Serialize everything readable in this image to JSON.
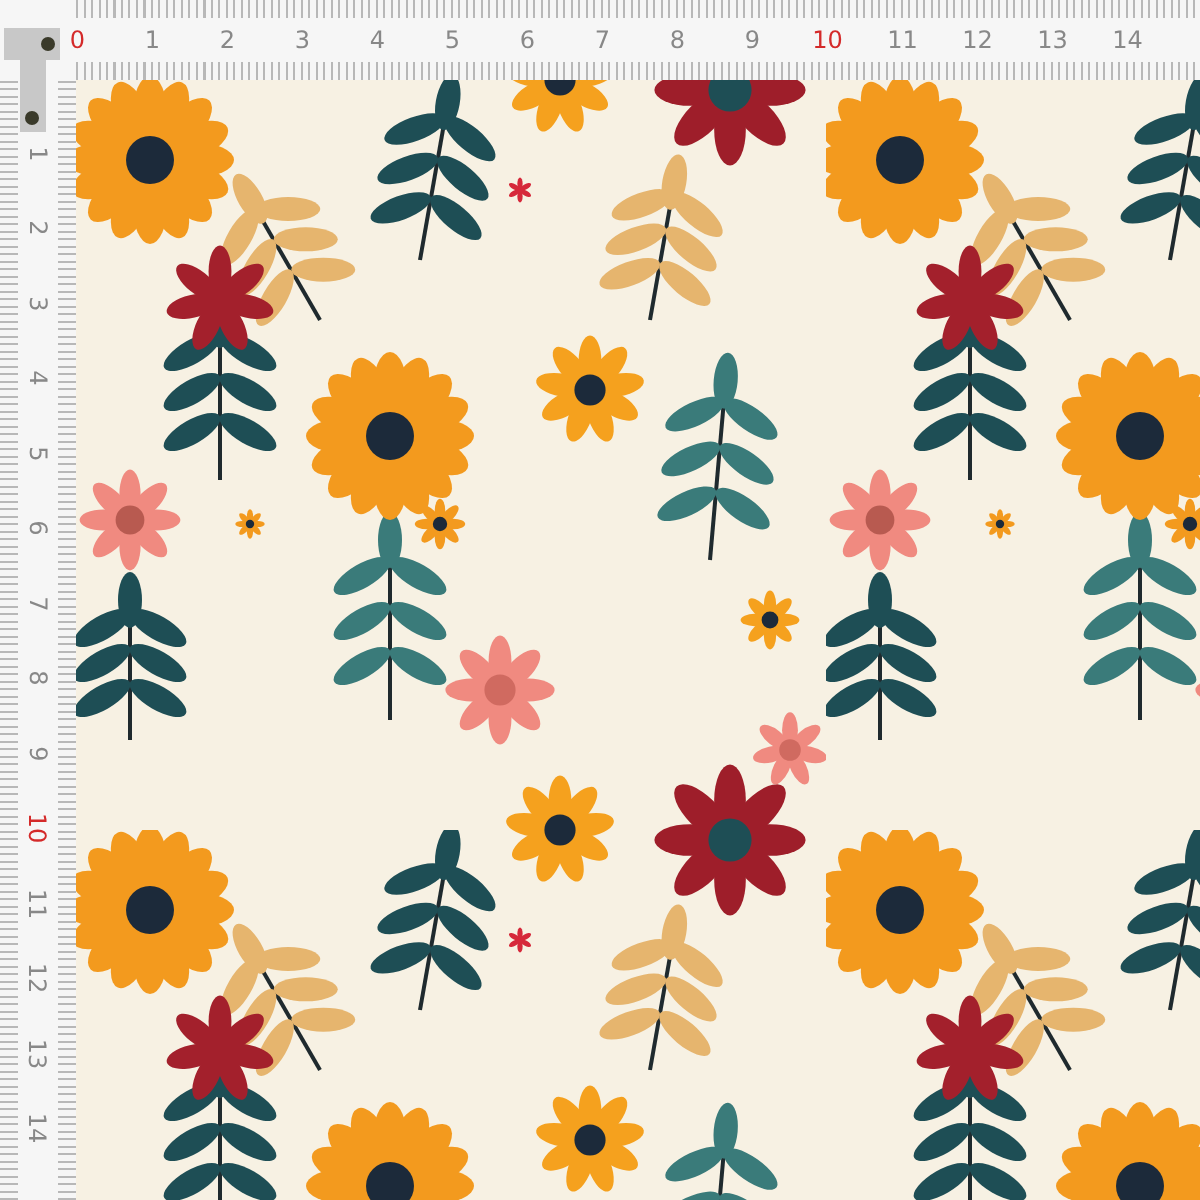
{
  "ruler_top": {
    "labels": [
      {
        "text": "0",
        "highlight": true
      },
      {
        "text": "1",
        "highlight": false
      },
      {
        "text": "2",
        "highlight": false
      },
      {
        "text": "3",
        "highlight": false
      },
      {
        "text": "4",
        "highlight": false
      },
      {
        "text": "5",
        "highlight": false
      },
      {
        "text": "6",
        "highlight": false
      },
      {
        "text": "7",
        "highlight": false
      },
      {
        "text": "8",
        "highlight": false
      },
      {
        "text": "9",
        "highlight": false
      },
      {
        "text": "10",
        "highlight": true
      },
      {
        "text": "11",
        "highlight": false
      },
      {
        "text": "12",
        "highlight": false
      },
      {
        "text": "13",
        "highlight": false
      },
      {
        "text": "14",
        "highlight": false
      }
    ]
  },
  "ruler_left": {
    "labels": [
      {
        "text": "1",
        "highlight": false
      },
      {
        "text": "2",
        "highlight": false
      },
      {
        "text": "3",
        "highlight": false
      },
      {
        "text": "4",
        "highlight": false
      },
      {
        "text": "5",
        "highlight": false
      },
      {
        "text": "6",
        "highlight": false
      },
      {
        "text": "7",
        "highlight": false
      },
      {
        "text": "8",
        "highlight": false
      },
      {
        "text": "9",
        "highlight": false
      },
      {
        "text": "10",
        "highlight": true
      },
      {
        "text": "11",
        "highlight": false
      },
      {
        "text": "12",
        "highlight": false
      },
      {
        "text": "13",
        "highlight": false
      },
      {
        "text": "14",
        "highlight": false
      }
    ]
  }
}
